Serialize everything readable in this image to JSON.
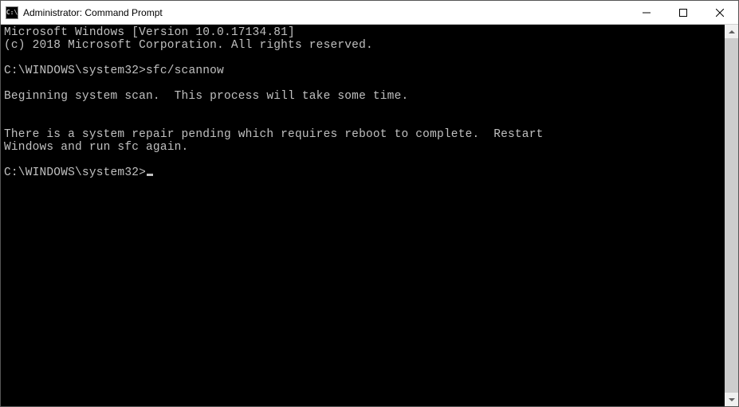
{
  "window": {
    "title": "Administrator: Command Prompt"
  },
  "console": {
    "line1": "Microsoft Windows [Version 10.0.17134.81]",
    "line2": "(c) 2018 Microsoft Corporation. All rights reserved.",
    "blank1": "",
    "prompt1": "C:\\WINDOWS\\system32>",
    "command1": "sfc/scannow",
    "blank2": "",
    "msg1": "Beginning system scan.  This process will take some time.",
    "blank3": "",
    "blank4": "",
    "msg2": "There is a system repair pending which requires reboot to complete.  Restart",
    "msg3": "Windows and run sfc again.",
    "blank5": "",
    "prompt2": "C:\\WINDOWS\\system32>"
  }
}
